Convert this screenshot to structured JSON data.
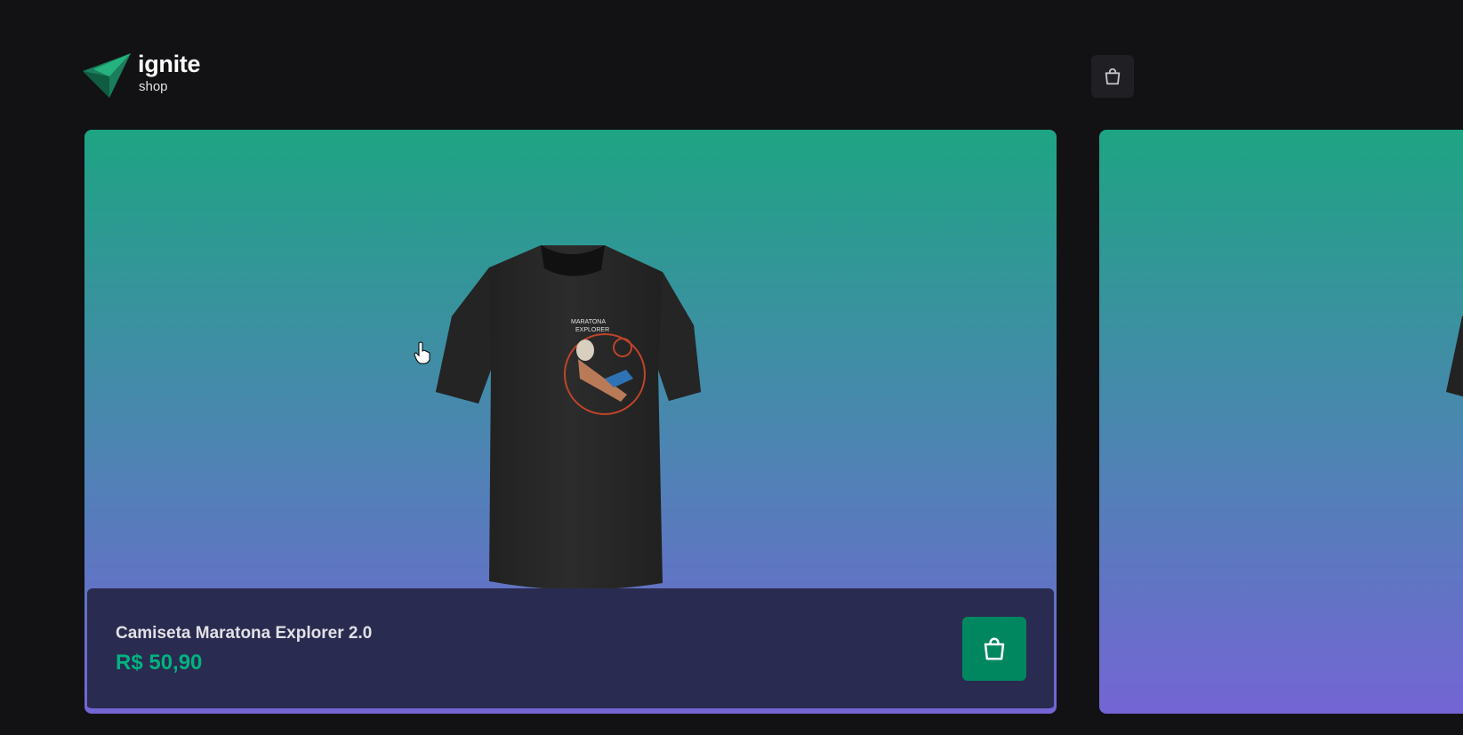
{
  "header": {
    "logo_title": "ignite",
    "logo_subtitle": "shop",
    "cart_icon": "shopping-bag-icon"
  },
  "products": [
    {
      "name": "Camiseta Maratona Explorer 2.0",
      "price": "R$ 50,90",
      "image_alt": "tshirt-image",
      "cart_icon": "shopping-bag-icon"
    }
  ],
  "colors": {
    "background": "#121214",
    "card_gradient_top": "#1ea483",
    "card_gradient_bottom": "#7465d4",
    "footer_background": "#2a2b50",
    "price": "#00b37e",
    "add_button": "#00875f",
    "cart_button": "#202024"
  }
}
